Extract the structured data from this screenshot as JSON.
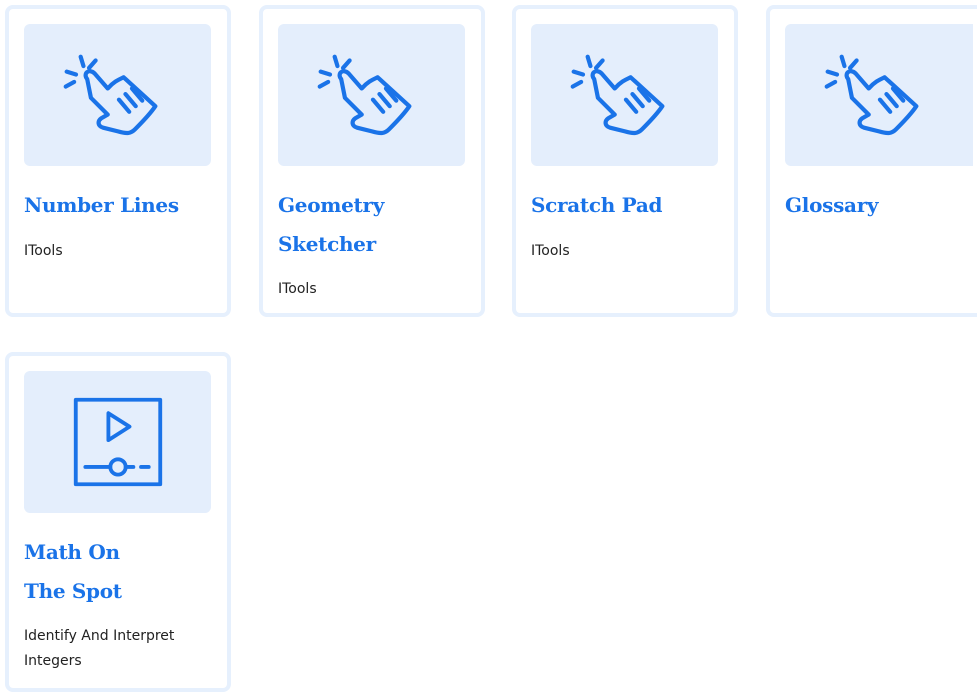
{
  "cards": [
    {
      "title": "Number Lines",
      "subtitle": "ITools",
      "icon": "tap-hand-icon"
    },
    {
      "title": "Geometry Sketcher",
      "subtitle": "ITools",
      "icon": "tap-hand-icon"
    },
    {
      "title": "Scratch Pad",
      "subtitle": "ITools",
      "icon": "tap-hand-icon"
    },
    {
      "title": "Glossary",
      "subtitle": "",
      "icon": "tap-hand-icon"
    },
    {
      "title": "Math On The Spot",
      "subtitle": "Identify And Interpret Integers",
      "icon": "video-player-icon"
    }
  ],
  "colors": {
    "accent": "#1a73e8",
    "thumb_bg": "#e4eefc",
    "card_border": "#e6f0fd"
  }
}
